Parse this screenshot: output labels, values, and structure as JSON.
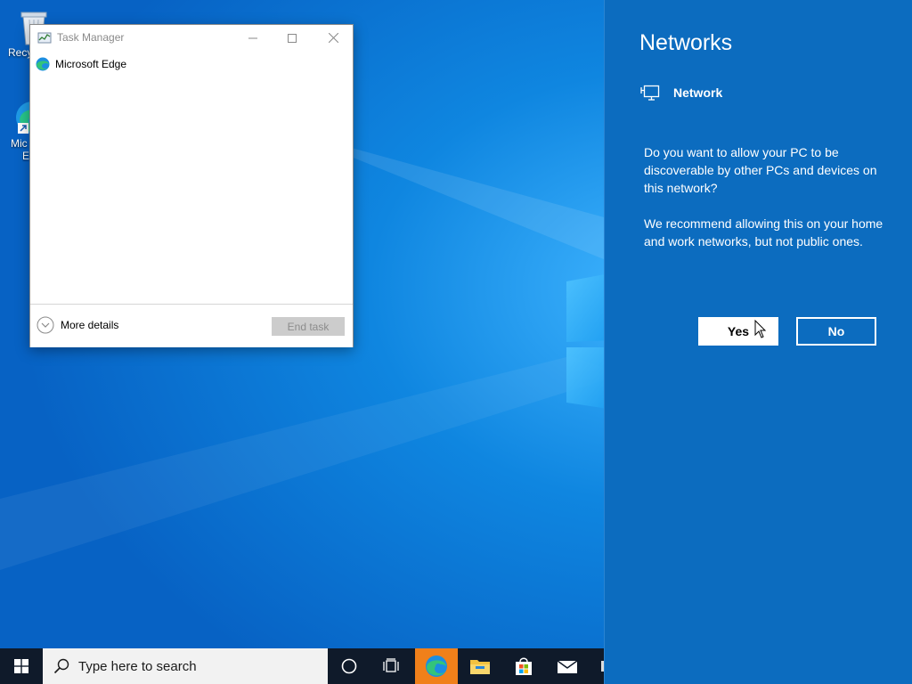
{
  "desktop": {
    "icons": [
      {
        "label": "Recy",
        "icon": "recycle-bin-icon"
      },
      {
        "label": "Mic",
        "label2": "E",
        "icon": "edge-shortcut-icon"
      }
    ]
  },
  "task_manager": {
    "title": "Task Manager",
    "controls": {
      "minimize": "minimize-icon",
      "maximize": "maximize-icon",
      "close": "close-icon"
    },
    "apps": [
      {
        "name": "Microsoft Edge",
        "icon": "edge-icon"
      }
    ],
    "footer": {
      "more_details_label": "More details",
      "end_task_label": "End task",
      "end_task_enabled": false
    }
  },
  "networks_flyout": {
    "title": "Networks",
    "network_name": "Network",
    "network_icon": "ethernet-icon",
    "question": "Do you want to allow your PC to be discoverable by other PCs and devices on this network?",
    "recommendation": "We recommend allowing this on your home and work networks, but not public ones.",
    "yes_label": "Yes",
    "no_label": "No",
    "accent_color": "#0c6cbf"
  },
  "taskbar": {
    "start_icon": "windows-start-icon",
    "search_placeholder": "Type here to search",
    "buttons": [
      {
        "icon": "cortana-icon"
      },
      {
        "icon": "task-view-icon"
      },
      {
        "icon": "edge-icon",
        "active": true
      },
      {
        "icon": "file-explorer-icon"
      },
      {
        "icon": "store-icon"
      },
      {
        "icon": "mail-icon"
      }
    ]
  }
}
